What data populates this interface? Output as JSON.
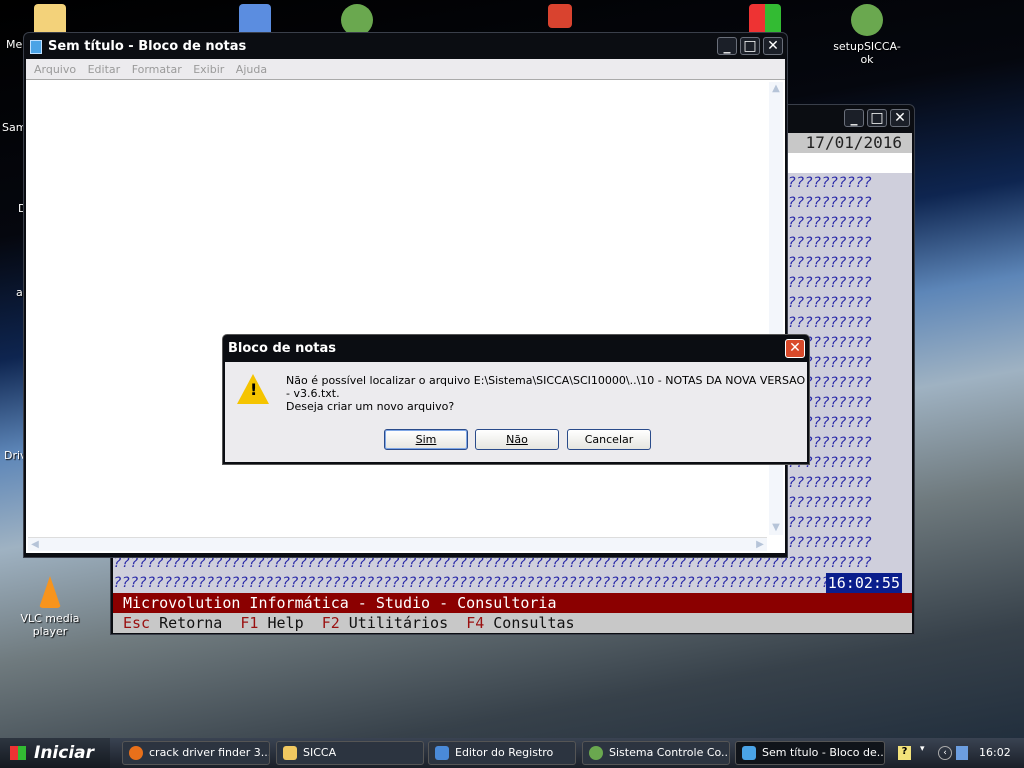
{
  "desktop": {
    "icons": [
      {
        "label": ""
      },
      {
        "label": ""
      },
      {
        "label": ""
      },
      {
        "label": ""
      },
      {
        "label": ""
      },
      {
        "label": "setupSICCA-ok"
      },
      {
        "label": "VLC media player"
      }
    ],
    "edge_labels": [
      "Me",
      "Sam",
      "D",
      "a",
      "Driv"
    ]
  },
  "sicca": {
    "date": "17/01/2016",
    "fill_char": "?",
    "clock": "16:02:55",
    "company_bar": "Microvolution Informática - Studio - Consultoria",
    "keys": [
      {
        "key": "Esc",
        "label": "Retorna"
      },
      {
        "key": "F1",
        "label": "Help"
      },
      {
        "key": "F2",
        "label": "Utilitários"
      },
      {
        "key": "F4",
        "label": "Consultas"
      }
    ],
    "colors": {
      "red_bar": "#8b0000",
      "pattern": "#2a2aa8",
      "clock_bg": "#0a1e8c"
    }
  },
  "notepad": {
    "title": "Sem título - Bloco de notas",
    "menu": [
      "Arquivo",
      "Editar",
      "Formatar",
      "Exibir",
      "Ajuda"
    ]
  },
  "dialog": {
    "title": "Bloco de notas",
    "message": "Não é possível localizar o arquivo E:\\Sistema\\SICCA\\SCI10000\\..\\10 - NOTAS DA NOVA VERSAO - v3.6.txt.",
    "question": "Deseja criar um novo arquivo?",
    "buttons": {
      "yes": "Sim",
      "no": "Não",
      "cancel": "Cancelar"
    }
  },
  "taskbar": {
    "start": "Iniciar",
    "tasks": [
      "crack driver finder 3...",
      "SICCA",
      "Editor do Registro",
      "Sistema Controle Co...",
      "Sem título - Bloco de..."
    ],
    "clock": "16:02"
  }
}
